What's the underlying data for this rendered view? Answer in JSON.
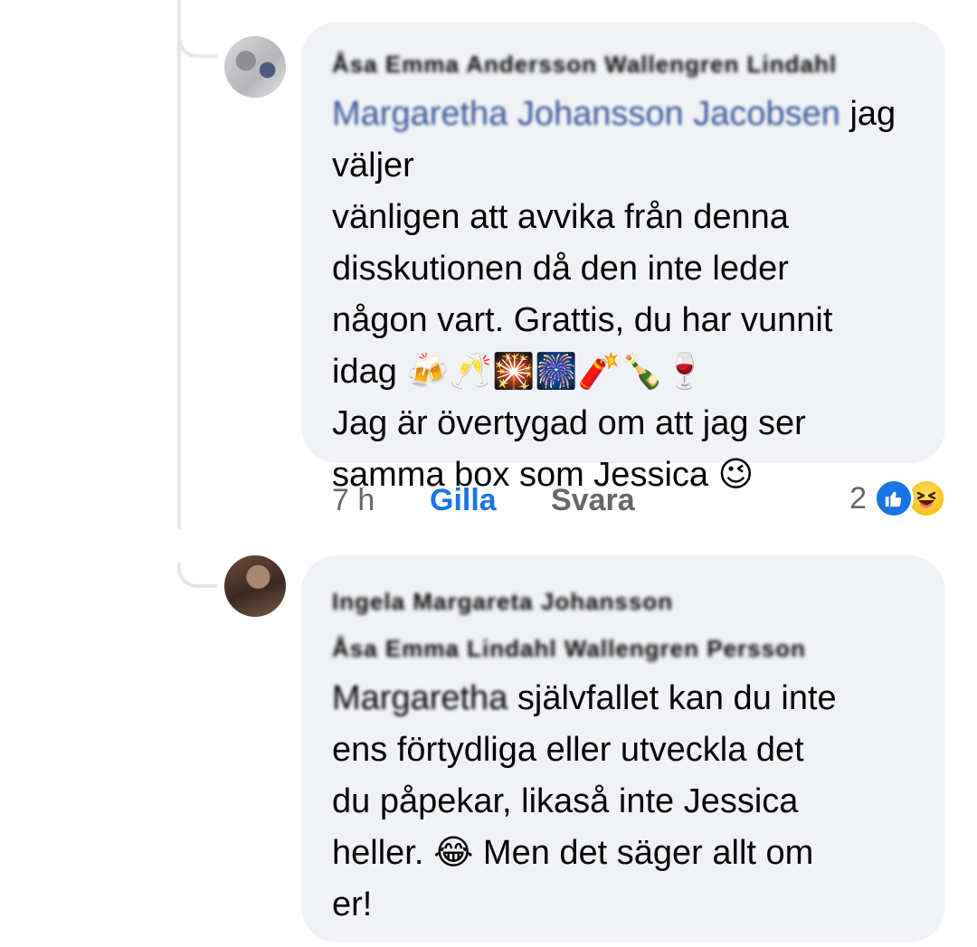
{
  "comments": [
    {
      "author": "Åsa Emma Andersson Wallengren Lindahl",
      "mention": "Margaretha Johansson Jacobsen",
      "text_line1": " jag väljer",
      "text_rest": "vänligen att avvika från denna\ndisskutionen då den inte leder\nnågon vart. Grattis, du har vunnit\nidag 🍻🥂🎇🎆🧨🍾🍷\nJag är övertygad om att jag ser\nsamma box som Jessica 😉",
      "time": "7 h",
      "like_label": "Gilla",
      "reply_label": "Svara",
      "reaction_count": "2",
      "reactions": [
        "like-icon",
        "haha-icon"
      ]
    },
    {
      "author": "Ingela Margareta Johansson",
      "author_line2": "Åsa Emma Lindahl Wallengren Persson",
      "mention": "Margaretha",
      "text_line1": " självfallet kan du inte",
      "text_rest": "ens förtydliga eller utveckla det\ndu påpekar, likaså inte Jessica\nheller. 😂 Men det säger allt om\ner!"
    }
  ],
  "colors": {
    "link_blue": "#1b74e4",
    "bubble_bg": "#f0f2f5",
    "meta_gray": "#65676b"
  }
}
